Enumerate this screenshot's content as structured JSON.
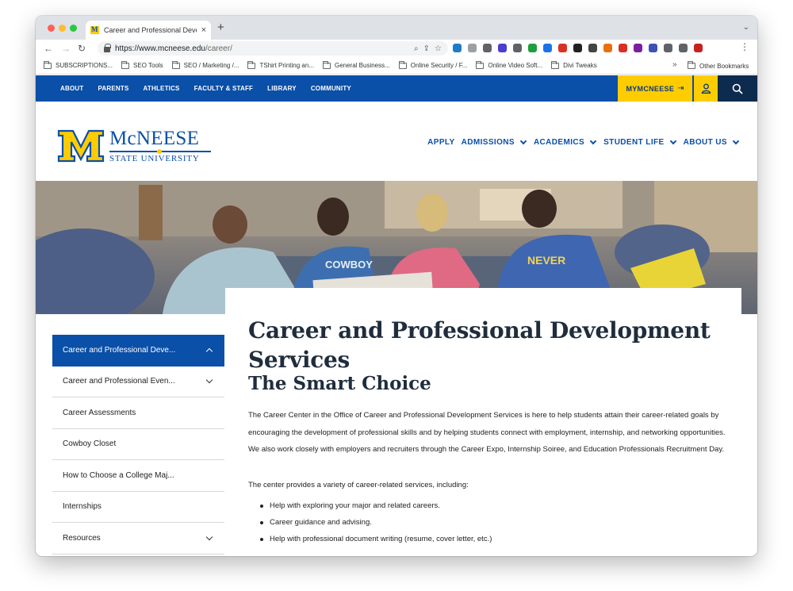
{
  "browser": {
    "tab_title": "Career and Professional Develo",
    "url_prefix": "https://www.mcneese.edu",
    "url_path": "/career/",
    "bookmarks": [
      "SUBSCRIPTIONS...",
      "SEO Tools",
      "SEO / Marketing /...",
      "TShirt Printing an...",
      "General Business...",
      "Online Security / F...",
      "Online Video Soft...",
      "Divi Tweaks"
    ],
    "other_bookmarks": "Other Bookmarks",
    "extension_colors": [
      "#1e7bc8",
      "#9aa0a6",
      "#5f6368",
      "#4a3fd0",
      "#5f6368",
      "#1e9e3e",
      "#1a73e8",
      "#d93025",
      "#202124",
      "#444",
      "#e8710a",
      "#d93025",
      "#7b1fa2",
      "#3f51b5",
      "#5f6368",
      "#5f6368",
      "#c5221f"
    ]
  },
  "site": {
    "utility_links": [
      "ABOUT",
      "PARENTS",
      "ATHLETICS",
      "FACULTY & STAFF",
      "LIBRARY",
      "COMMUNITY"
    ],
    "mymcneese_label": "MYMCNEESE",
    "logo_name": "McNEESE",
    "logo_sub": "STATE UNIVERSITY",
    "main_nav": [
      {
        "label": "APPLY",
        "dropdown": false
      },
      {
        "label": "ADMISSIONS",
        "dropdown": true
      },
      {
        "label": "ACADEMICS",
        "dropdown": true
      },
      {
        "label": "STUDENT LIFE",
        "dropdown": true
      },
      {
        "label": "ABOUT US",
        "dropdown": true
      }
    ],
    "colors": {
      "brand_blue": "#0a4fa8",
      "brand_gold": "#ffcc00",
      "navy": "#0d2b4e"
    }
  },
  "sidebar": {
    "items": [
      {
        "label": "Career and Professional Deve...",
        "active": true,
        "chevron": "up"
      },
      {
        "label": "Career and Professional Even...",
        "active": false,
        "chevron": "down"
      },
      {
        "label": "Career Assessments",
        "active": false,
        "chevron": ""
      },
      {
        "label": "Cowboy Closet",
        "active": false,
        "chevron": ""
      },
      {
        "label": "How to Choose a College Maj...",
        "active": false,
        "chevron": ""
      },
      {
        "label": "Internships",
        "active": false,
        "chevron": ""
      },
      {
        "label": "Resources",
        "active": false,
        "chevron": "down"
      }
    ]
  },
  "content": {
    "title": "Career and Professional Development Services",
    "subtitle": "The Smart Choice",
    "intro": "The Career Center in the Office of Career and Professional Development Services is here to help students attain their career-related goals by encouraging the development of professional skills and by helping students connect with employment, internship, and networking opportunities. We also work closely with employers and recruiters through the Career Expo, Internship Soiree, and Education Professionals Recruitment Day.",
    "lead": "The center provides a variety of career-related services, including:",
    "bullets": [
      "Help with exploring your major and related careers.",
      "Career guidance and advising.",
      "Help with professional document writing (resume, cover letter, etc.)"
    ]
  }
}
